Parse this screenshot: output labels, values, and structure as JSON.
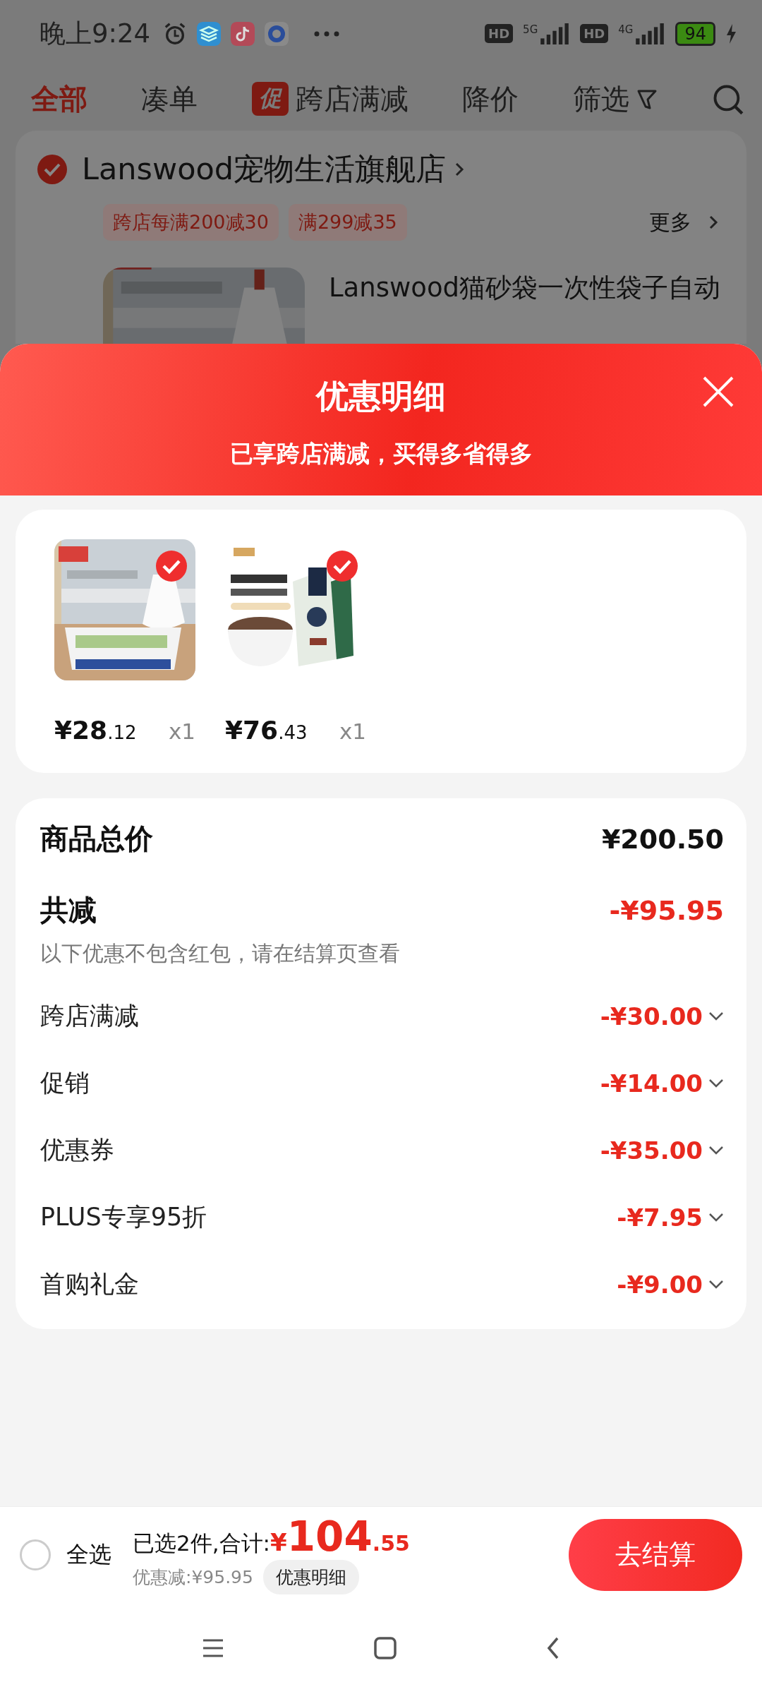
{
  "status_bar": {
    "time": "晚上9:24",
    "networks": [
      {
        "hd": "HD",
        "gen": "5G"
      },
      {
        "hd": "HD",
        "gen": "4G"
      }
    ],
    "battery": "94"
  },
  "filter_tabs": [
    {
      "label": "全部",
      "selected": true
    },
    {
      "label": "凑单",
      "selected": false
    },
    {
      "label": "跨店满减",
      "badge": "促",
      "selected": false
    },
    {
      "label": "降价",
      "selected": false
    }
  ],
  "filter_button": {
    "label": "筛选"
  },
  "store": {
    "name": "Lanswood宠物生活旗舰店",
    "checked": true,
    "promos": [
      "跨店每满200减30",
      "满299减35"
    ],
    "more": "更多"
  },
  "store_item": {
    "title": "Lanswood猫砂袋一次性袋子自动"
  },
  "sheet": {
    "title": "优惠明细",
    "subtitle": "已享跨店满减，买得多省得多"
  },
  "products": [
    {
      "kind": "bags",
      "price": "¥28",
      "cents": ".12",
      "qty": "x1",
      "selected": true
    },
    {
      "kind": "food",
      "price": "¥76",
      "cents": ".43",
      "qty": "x1",
      "selected": true
    }
  ],
  "summary": {
    "total_label": "商品总价",
    "total": "¥200.50",
    "discount_label": "共减",
    "discount": "-¥95.95",
    "note": "以下优惠不包含红包，请在结算页查看",
    "items": [
      {
        "label": "跨店满减",
        "amount": "-¥30.00"
      },
      {
        "label": "促销",
        "amount": "-¥14.00"
      },
      {
        "label": "优惠券",
        "amount": "-¥35.00"
      },
      {
        "label": "PLUS专享95折",
        "amount": "-¥7.95"
      },
      {
        "label": "首购礼金",
        "amount": "-¥9.00"
      }
    ]
  },
  "footer": {
    "select_all": {
      "label": "全选",
      "checked": false
    },
    "selected_text": "已选2件,合计:",
    "currency": "¥",
    "total": "104",
    "cents": ".55",
    "saved": "优惠减:¥95.95",
    "detail_button": "优惠明细",
    "checkout": "去结算"
  }
}
